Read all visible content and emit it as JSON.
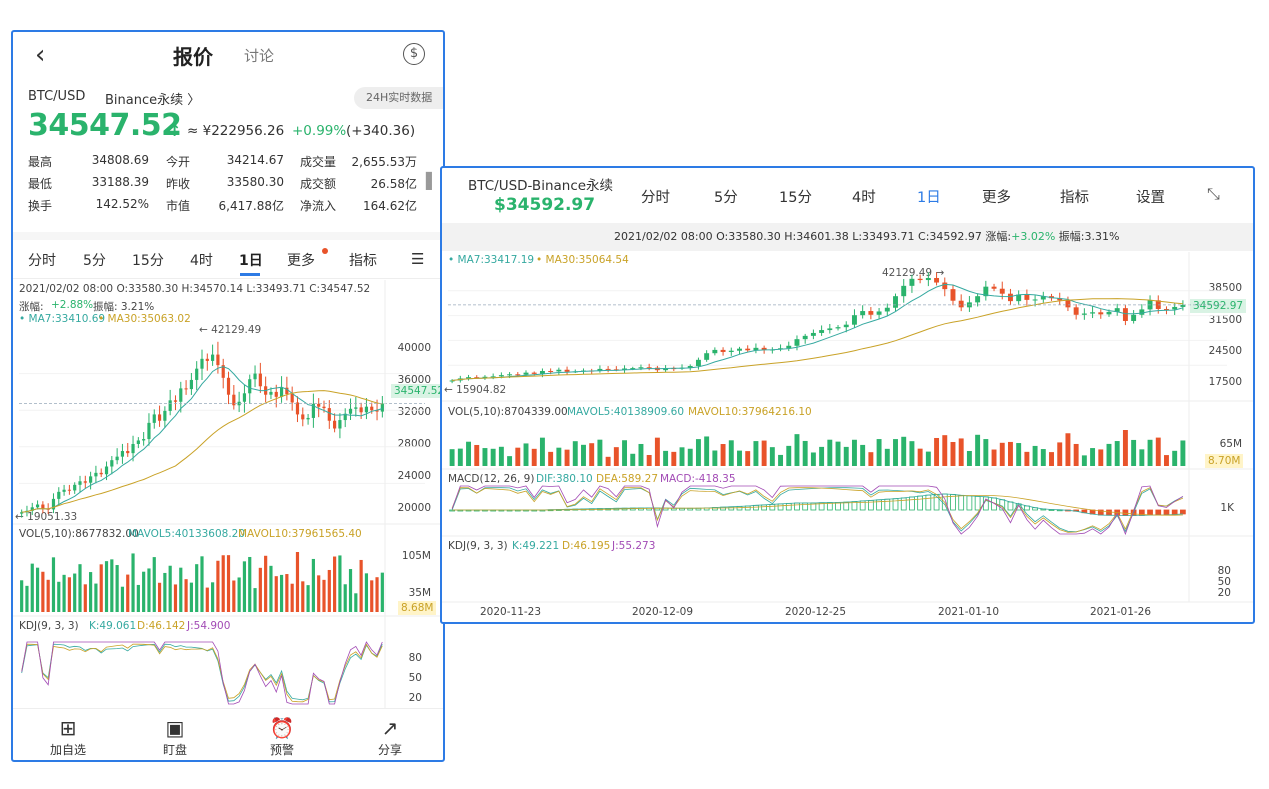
{
  "left": {
    "header": {
      "back_icon": "chevron-left-icon",
      "title": "报价",
      "discuss": "讨论",
      "dollar_icon": "dollar-circle-icon",
      "dollar_glyph": "$"
    },
    "pair": "BTC/USD",
    "exchange": "Binance永续 〉",
    "badge": "24H实时数据",
    "price": "34547.52",
    "price_arrow": "↑",
    "cny": "≈ ¥222956.26",
    "change_pct": "+0.99%",
    "change_abs": "(+340.36)",
    "stats": [
      {
        "label": "最高",
        "value": "34808.69",
        "label2": "今开",
        "value2": "34214.67",
        "label3": "成交量",
        "value3": "2,655.53万"
      },
      {
        "label": "最低",
        "value": "33188.39",
        "label2": "昨收",
        "value2": "33580.30",
        "label3": "成交额",
        "value3": "26.58亿"
      },
      {
        "label": "换手",
        "value": "142.52%",
        "label2": "市值",
        "value2": "6,417.88亿",
        "label3": "净流入",
        "value3": "164.62亿"
      }
    ],
    "tabs": [
      "分时",
      "5分",
      "15分",
      "4时",
      "1日",
      "更多",
      "指标"
    ],
    "active_tab": "1日",
    "settings_icon": "sliders-icon",
    "ohlc_line": "2021/02/02 08:00  O:33580.30 H:34570.14 L:33493.71 C:34547.52",
    "amp_label": "涨幅:",
    "amp_value": "+2.88%",
    "range_text": "振幅: 3.21%",
    "ma7": "MA7:33410.69",
    "ma30": "MA30:35063.02",
    "high_marker": "← 42129.49",
    "low_marker": "← 19051.33",
    "price_axis": [
      "40000",
      "36000",
      "32000",
      "28000",
      "24000",
      "20000"
    ],
    "price_tag": "34547.52",
    "vol_line": "VOL(5,10):8677832.00",
    "mavol5": "MAVOL5:40133608.20",
    "mavol10": "MAVOL10:37961565.40",
    "vol_axis": [
      "105M",
      "35M"
    ],
    "vol_tag": "8.68M",
    "kdj_label": "KDJ(9, 3, 3)",
    "kdj_k": "K:49.061",
    "kdj_d": "D:46.142",
    "kdj_j": "J:54.900",
    "kdj_axis": [
      "80",
      "50",
      "20"
    ],
    "bottom": [
      {
        "icon": "plus-square-icon",
        "glyph": "⊞",
        "label": "加自选"
      },
      {
        "icon": "chart-monitor-icon",
        "glyph": "▣",
        "label": "盯盘"
      },
      {
        "icon": "alarm-clock-icon",
        "glyph": "⏰",
        "label": "预警"
      },
      {
        "icon": "share-icon",
        "glyph": "↗",
        "label": "分享"
      }
    ]
  },
  "right": {
    "pair": "BTC/USD-Binance永续",
    "price": "$34592.97",
    "tabs": [
      "分时",
      "5分",
      "15分",
      "4时",
      "1日",
      "更多",
      "指标",
      "设置"
    ],
    "active_tab": "1日",
    "collapse_icon": "collapse-arrows-icon",
    "info_prefix": "2021/02/02 08:00  O:33580.30 H:34601.38 L:33493.71 C:34592.97  涨幅:",
    "info_pct": "+3.02%",
    "info_amp": "振幅:3.31%",
    "ma7": "MA7:33417.19",
    "ma30": "MA30:35064.54",
    "high_marker": "42129.49 →",
    "low_marker": "← 15904.82",
    "price_axis": [
      "38500",
      "31500",
      "24500",
      "17500"
    ],
    "price_tag": "34592.97",
    "vol_line": "VOL(5,10):8704339.00",
    "mavol5": "MAVOL5:40138909.60",
    "mavol10": "MAVOL10:37964216.10",
    "vol_axis": [
      "65M"
    ],
    "vol_tag": "8.70M",
    "macd_label": "MACD(12, 26, 9)",
    "macd_dif": "DIF:380.10",
    "macd_dea": "DEA:589.27",
    "macd_val": "MACD:-418.35",
    "macd_axis": [
      "1K"
    ],
    "kdj_label": "KDJ(9, 3, 3)",
    "kdj_k": "K:49.221",
    "kdj_d": "D:46.195",
    "kdj_j": "J:55.273",
    "kdj_axis": [
      "80",
      "50",
      "20"
    ],
    "dates": [
      "2020-11-23",
      "2020-12-09",
      "2020-12-25",
      "2021-01-10",
      "2021-01-26"
    ]
  },
  "colors": {
    "up": "#2ab36c",
    "down": "#e8532a",
    "accent": "#2d7be5",
    "ma7": "#35a9a0",
    "ma30": "#c9a227",
    "j": "#a24bb5"
  },
  "chart_data": [
    {
      "type": "candlestick",
      "title": "BTC/USD 1日 (left)",
      "close": [
        19100,
        19300,
        19800,
        20200,
        19600,
        19500,
        21000,
        22000,
        22300,
        22200,
        23000,
        23500,
        23300,
        24200,
        24700,
        24500,
        25600,
        26500,
        27000,
        27800,
        27500,
        28800,
        29300,
        29500,
        31800,
        33000,
        32100,
        33500,
        35000,
        34800,
        36700,
        36600,
        37900,
        39500,
        40900,
        40600,
        41500,
        40000,
        38200,
        35800,
        34300,
        34800,
        36000,
        38000,
        38800,
        37000,
        35800,
        36200,
        35500,
        36800,
        35900,
        34700,
        33000,
        32300,
        32500,
        34500,
        34100,
        33900,
        32100,
        31000,
        32200,
        33100,
        33800,
        34000,
        33300,
        34100,
        33600,
        33400,
        34547
      ]
    },
    {
      "type": "candlestick",
      "title": "BTC/USD-Binance永续 1日 (right)",
      "close": [
        16300,
        16800,
        17100,
        17000,
        17200,
        17300,
        17600,
        17800,
        17700,
        18200,
        17900,
        18600,
        18500,
        18900,
        18400,
        18500,
        18700,
        18600,
        19100,
        19000,
        18900,
        19200,
        19300,
        19500,
        19400,
        18800,
        19300,
        19200,
        19400,
        19800,
        21300,
        22900,
        23700,
        23200,
        23500,
        24000,
        23600,
        24200,
        23700,
        23800,
        24100,
        24700,
        26300,
        27100,
        27800,
        28500,
        28900,
        29200,
        29800,
        32100,
        33100,
        32200,
        33000,
        33900,
        36700,
        39200,
        40900,
        40600,
        41100,
        40000,
        38400,
        35600,
        34000,
        35200,
        36700,
        39000,
        38500,
        37300,
        35500,
        37100,
        35800,
        35900,
        36700,
        36200,
        35700,
        34000,
        32200,
        32500,
        32800,
        32300,
        32900,
        33800,
        30700,
        32200,
        33500,
        35700,
        33600,
        33500,
        34100,
        34593
      ]
    }
  ]
}
